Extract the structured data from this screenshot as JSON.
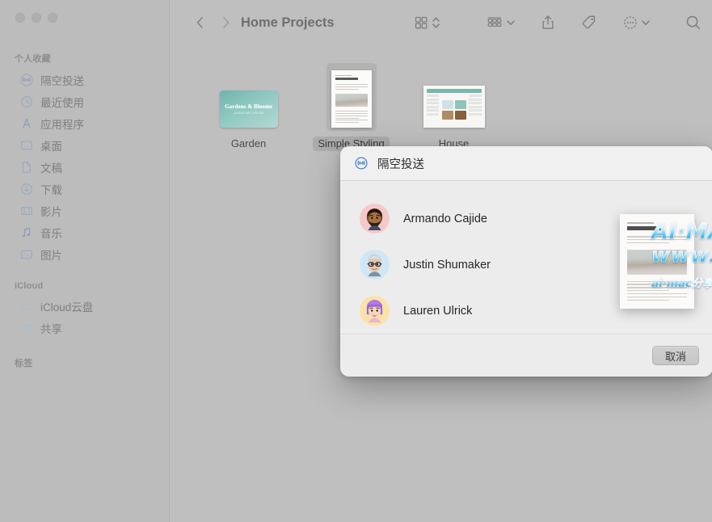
{
  "window": {
    "traffic_lights": [
      "close",
      "minimize",
      "zoom"
    ]
  },
  "sidebar": {
    "sections": [
      {
        "header": "个人收藏",
        "items": [
          {
            "label": "隔空投送",
            "icon": "airdrop-icon"
          },
          {
            "label": "最近使用",
            "icon": "clock-icon"
          },
          {
            "label": "应用程序",
            "icon": "applications-icon"
          },
          {
            "label": "桌面",
            "icon": "desktop-icon"
          },
          {
            "label": "文稿",
            "icon": "document-icon"
          },
          {
            "label": "下载",
            "icon": "download-icon"
          },
          {
            "label": "影片",
            "icon": "movies-icon"
          },
          {
            "label": "音乐",
            "icon": "music-note-icon"
          },
          {
            "label": "图片",
            "icon": "photos-icon"
          }
        ]
      },
      {
        "header": "iCloud",
        "items": [
          {
            "label": "iCloud云盘",
            "icon": "cloud-icon"
          },
          {
            "label": "共享",
            "icon": "shared-folder-icon"
          }
        ]
      },
      {
        "header": "标签",
        "items": []
      }
    ]
  },
  "toolbar": {
    "back_label": "后退",
    "forward_label": "前进",
    "folder_title": "Home Projects",
    "icons": {
      "back": "chevron-left-icon",
      "forward": "chevron-right-icon",
      "view_grid": "grid-view-icon",
      "view_chevrons": "chevron-up-down-icon",
      "group_by": "group-by-icon",
      "group_chevron": "chevron-down-icon",
      "share": "share-icon",
      "tag": "tag-icon",
      "more": "ellipsis-circle-icon",
      "more_chevron": "chevron-down-icon",
      "search": "search-icon"
    }
  },
  "files": [
    {
      "name": "Garden",
      "selected": false,
      "thumb": "card-thumbnail",
      "card_title": "Gardens & Blooms",
      "card_subtitle": "LANDSCAPE DESIGN"
    },
    {
      "name": "Simple Styling",
      "selected": true,
      "thumb": "document-thumbnail"
    },
    {
      "name": "House",
      "selected": false,
      "thumb": "spreadsheet-thumbnail"
    }
  ],
  "airdrop_dialog": {
    "title": "隔空投送",
    "icon": "airdrop-icon",
    "contacts": [
      {
        "name": "Armando Cajide",
        "avatar_bg": "#f6c9c9",
        "avatar": "memoji-armando"
      },
      {
        "name": "Justin Shumaker",
        "avatar_bg": "#cfe7f5",
        "avatar": "memoji-justin"
      },
      {
        "name": "Lauren Ulrick",
        "avatar_bg": "#fbe3a8",
        "avatar": "memoji-lauren"
      }
    ],
    "cancel_label": "取消"
  },
  "drag_preview": {
    "doc_eyebrow": "Simple Styling",
    "doc_title": "Inside Voice"
  },
  "watermark": {
    "line1": "AI·MAC分享站",
    "line2": "www.aimac.top",
    "line3": "ai·mac分享站原创，转载请保留出处"
  },
  "colors": {
    "window_bg": "#bfbfbf",
    "sidebar_bg": "#bcbcbc",
    "dialog_bg": "#ececec",
    "dialog_header_bg": "#f0f0f0",
    "accent_blue": "#2f7fd4",
    "watermark_cyan": "#2ea8e5"
  }
}
